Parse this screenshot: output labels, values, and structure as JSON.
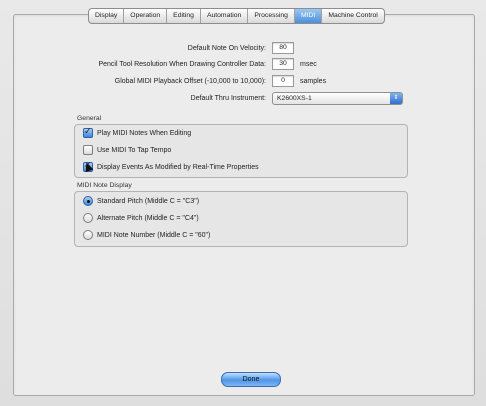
{
  "tabs": [
    {
      "label": "Display",
      "active": false
    },
    {
      "label": "Operation",
      "active": false
    },
    {
      "label": "Editing",
      "active": false
    },
    {
      "label": "Automation",
      "active": false
    },
    {
      "label": "Processing",
      "active": false
    },
    {
      "label": "MIDI",
      "active": true
    },
    {
      "label": "Machine Control",
      "active": false
    }
  ],
  "settings": {
    "velocity_label": "Default Note On Velocity:",
    "velocity_value": "80",
    "pencil_label": "Pencil Tool Resolution When Drawing Controller Data:",
    "pencil_value": "30",
    "pencil_unit": "msec",
    "offset_label": "Global MIDI Playback Offset (-10,000 to 10,000):",
    "offset_value": "0",
    "offset_unit": "samples",
    "thru_label": "Default Thru Instrument:",
    "thru_value": "K2600XS-1"
  },
  "general": {
    "title": "General",
    "options": [
      {
        "label": "Play MIDI Notes When Editing",
        "checked": true
      },
      {
        "label": "Use MIDI To Tap Tempo",
        "checked": false
      },
      {
        "label": "Display Events As Modified by Real-Time Properties",
        "checked": true
      }
    ]
  },
  "note_display": {
    "title": "MIDI Note Display",
    "options": [
      {
        "label": "Standard Pitch (Middle C = \"C3\")",
        "selected": true
      },
      {
        "label": "Alternate Pitch (Middle C = \"C4\")",
        "selected": false
      },
      {
        "label": "MIDI Note Number (Middle C = \"60\")",
        "selected": false
      }
    ]
  },
  "done_label": "Done",
  "colors": {
    "accent": "#4c8fdc",
    "panel": "#ececec"
  }
}
